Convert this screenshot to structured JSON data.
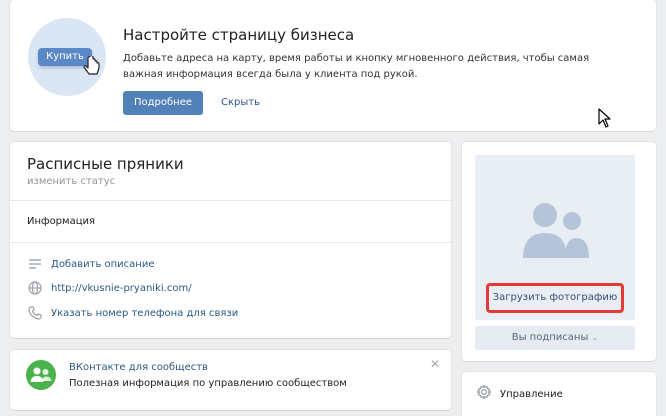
{
  "promo": {
    "buy_label": "Купить",
    "title": "Настройте страницу бизнеса",
    "description": "Добавьте адреса на карту, время работы и кнопку мгновенного действия, чтобы самая важная информация всегда была у клиента под рукой.",
    "more_button": "Подробнее",
    "hide_link": "Скрыть"
  },
  "profile": {
    "name": "Расписные пряники",
    "status_placeholder": "изменить статус",
    "info_title": "Информация",
    "rows": [
      {
        "icon": "description-lines-icon",
        "label": "Добавить описание"
      },
      {
        "icon": "globe-icon",
        "label": "http://vkusnie-pryaniki.com/"
      },
      {
        "icon": "phone-icon",
        "label": "Указать номер телефона для связи"
      }
    ]
  },
  "community": {
    "title": "ВКонтакте для сообществ",
    "text": "Полезная информация по управлению сообществом"
  },
  "photo": {
    "upload_label": "Загрузить фотографию",
    "subscribed_label": "Вы подписаны"
  },
  "manage": {
    "label": "Управление"
  },
  "colors": {
    "accent": "#5181b8",
    "link": "#2a5885",
    "highlight": "#e53935",
    "community_green": "#4bb34b"
  }
}
